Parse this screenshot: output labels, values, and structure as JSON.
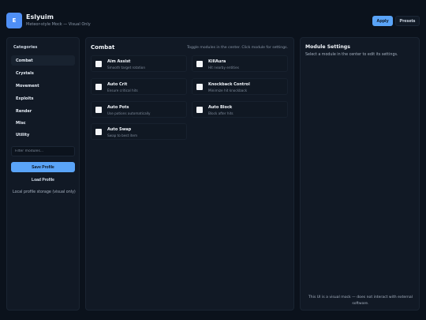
{
  "header": {
    "logo_letter": "E",
    "title": "Eslyuim",
    "subtitle": "Meteor-style Mock — Visual Only",
    "apply_label": "Apply",
    "presets_label": "Presets"
  },
  "sidebar": {
    "heading": "Categories",
    "categories": [
      {
        "label": "Combat",
        "active": true
      },
      {
        "label": "Crystals",
        "active": false
      },
      {
        "label": "Movement",
        "active": false
      },
      {
        "label": "Exploits",
        "active": false
      },
      {
        "label": "Render",
        "active": false
      },
      {
        "label": "Misc",
        "active": false
      },
      {
        "label": "Utility",
        "active": false
      }
    ],
    "filter_placeholder": "Filter modules...",
    "save_label": "Save Profile",
    "load_label": "Load Profile",
    "storage_note": "Local profile storage (visual only)"
  },
  "main": {
    "title": "Combat",
    "hint": "Toggle modules in the center. Click module for settings.",
    "modules": [
      {
        "name": "Aim Assist",
        "desc": "Smooth target rotation"
      },
      {
        "name": "KillAura",
        "desc": "Hit nearby entities"
      },
      {
        "name": "Auto Crit",
        "desc": "Ensure critical hits"
      },
      {
        "name": "Knockback Control",
        "desc": "Minimize hit knockback"
      },
      {
        "name": "Auto Pots",
        "desc": "Use potions automatically"
      },
      {
        "name": "Auto Block",
        "desc": "Block after hits"
      },
      {
        "name": "Auto Swap",
        "desc": "Swap to best item"
      }
    ]
  },
  "settings": {
    "title": "Module Settings",
    "hint": "Select a module in the center to edit its settings.",
    "disclaimer": "This UI is a visual mock — does not interact with external software."
  },
  "colors": {
    "accent": "#5aa4f8",
    "background": "#0b121c",
    "panel": "#111925"
  }
}
